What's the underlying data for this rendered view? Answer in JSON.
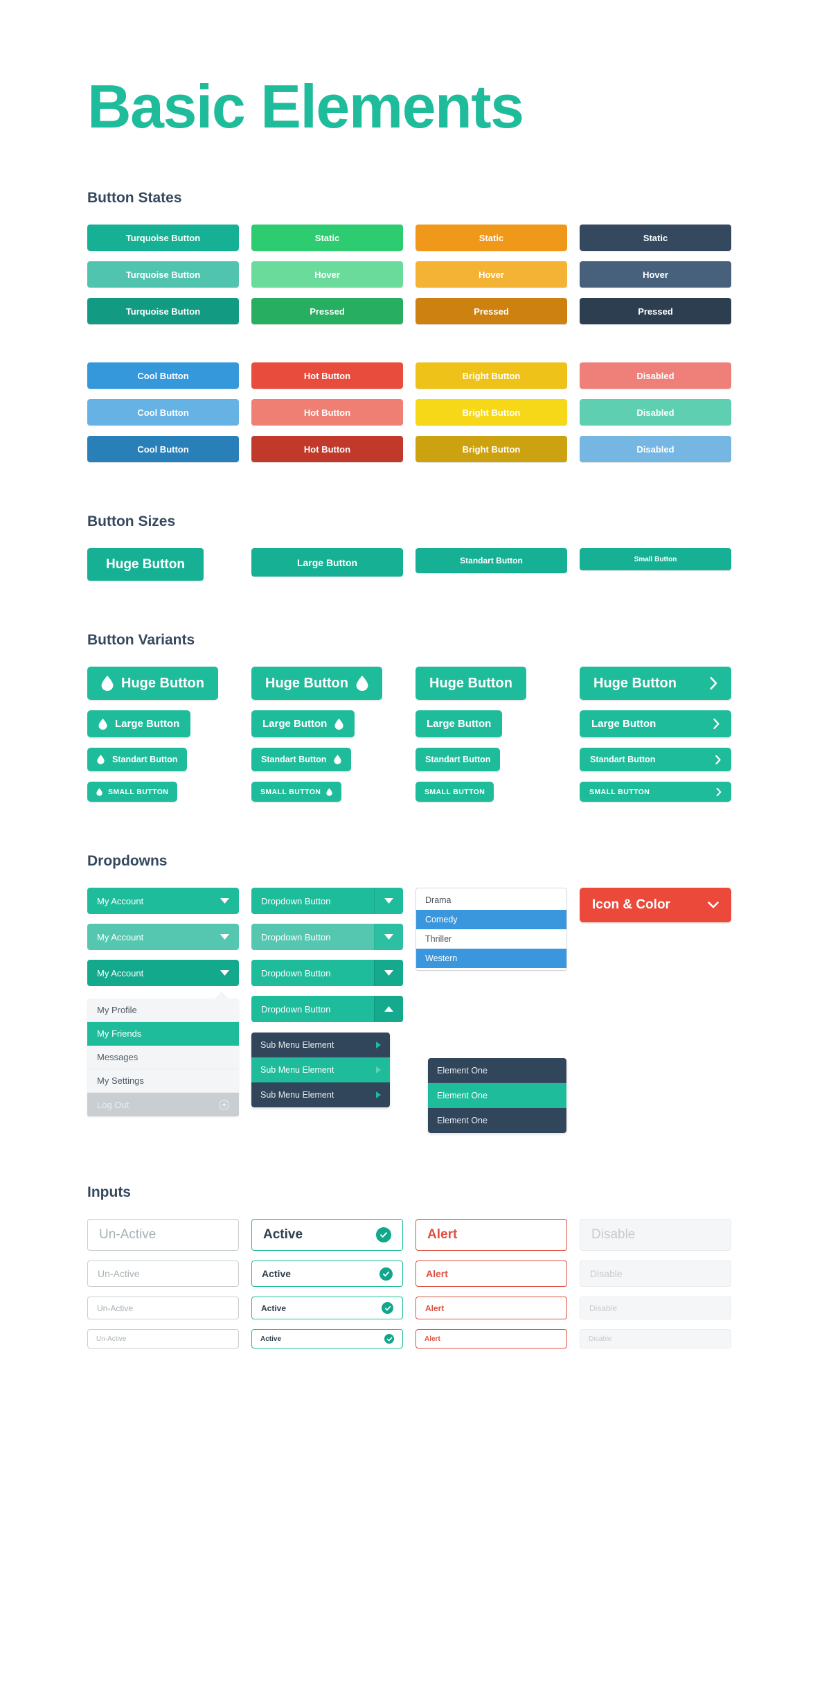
{
  "page": {
    "title": "Basic Elements",
    "accent": "#1ebc9b",
    "heading_color": "#34495e"
  },
  "sections": {
    "button_states": {
      "title": "Button States"
    },
    "button_sizes": {
      "title": "Button Sizes"
    },
    "button_variants": {
      "title": "Button Variants"
    },
    "dropdowns": {
      "title": "Dropdowns"
    },
    "inputs": {
      "title": "Inputs"
    }
  },
  "button_states": {
    "group_one": [
      {
        "name": "turquoise",
        "colors": {
          "static": "#16b194",
          "hover": "#50c4ae",
          "pressed": "#129b82"
        },
        "labels": {
          "static": "Turquoise Button",
          "hover": "Turquoise Button",
          "pressed": "Turquoise Button"
        }
      },
      {
        "name": "green",
        "colors": {
          "static": "#2ecc71",
          "hover": "#6bdb9b",
          "pressed": "#27ae60"
        },
        "labels": {
          "static": "Static",
          "hover": "Hover",
          "pressed": "Pressed"
        }
      },
      {
        "name": "orange",
        "colors": {
          "static": "#f09819",
          "hover": "#f5b335",
          "pressed": "#cd8110"
        },
        "labels": {
          "static": "Static",
          "hover": "Hover",
          "pressed": "Pressed"
        }
      },
      {
        "name": "dark",
        "colors": {
          "static": "#34495e",
          "hover": "#47617d",
          "pressed": "#2c3e50"
        },
        "labels": {
          "static": "Static",
          "hover": "Hover",
          "pressed": "Pressed"
        }
      }
    ],
    "group_two": [
      {
        "name": "cool",
        "colors": {
          "static": "#3498db",
          "hover": "#66b2e5",
          "pressed": "#2980b9"
        },
        "labels": {
          "static": "Cool Button",
          "hover": "Cool Button",
          "pressed": "Cool Button"
        }
      },
      {
        "name": "hot",
        "colors": {
          "static": "#e74c3c",
          "hover": "#ef7f72",
          "pressed": "#c0392b"
        },
        "labels": {
          "static": "Hot Button",
          "hover": "Hot Button",
          "pressed": "Hot Button"
        }
      },
      {
        "name": "bright",
        "colors": {
          "static": "#eec218",
          "hover": "#f6d818",
          "pressed": "#cca211"
        },
        "labels": {
          "static": "Bright Button",
          "hover": "Bright Button",
          "pressed": "Bright Button"
        }
      },
      {
        "name": "disabled",
        "colors": {
          "static": "#ef8079",
          "hover": "#5fcfb2",
          "pressed": "#75b6e3"
        },
        "labels": {
          "static": "Disabled",
          "hover": "Disabled",
          "pressed": "Disabled"
        }
      }
    ]
  },
  "button_sizes": [
    {
      "label": "Huge Button",
      "size": "huge"
    },
    {
      "label": "Large Button",
      "size": "large"
    },
    {
      "label": "Standart Button",
      "size": "standart"
    },
    {
      "label": "Small Button",
      "size": "small"
    }
  ],
  "button_variants": {
    "icon_name": "water-drop-icon",
    "arrow_icon_name": "chevron-right-icon",
    "rows": [
      {
        "size": "huge",
        "icon_left": "Huge Button",
        "icon_right": "Huge Button",
        "plain": "Huge Button",
        "arrow": "Huge Button"
      },
      {
        "size": "large",
        "icon_left": "Large Button",
        "icon_right": "Large Button",
        "plain": "Large Button",
        "arrow": "Large Button"
      },
      {
        "size": "standart",
        "icon_left": "Standart Button",
        "icon_right": "Standart Button",
        "plain": "Standart Button",
        "arrow": "Standart Button"
      },
      {
        "size": "small",
        "icon_left": "SMALL BUTTON",
        "icon_right": "SMALL BUTTON",
        "plain": "SMALL BUTTON",
        "arrow": "SMALL BUTTON"
      }
    ]
  },
  "dropdowns": {
    "account": {
      "static": "My Account",
      "hover": "My Account",
      "pressed": "My Account",
      "caret_icon": "caret-down-icon"
    },
    "split": {
      "static": "Dropdown Button",
      "hover": "Dropdown Button",
      "pressed": "Dropdown Button",
      "open": "Dropdown Button",
      "caret_down_icon": "caret-down-icon",
      "caret_up_icon": "caret-up-icon"
    },
    "select_list": {
      "options": [
        {
          "label": "Drama",
          "selected": false
        },
        {
          "label": "Comedy",
          "selected": true
        },
        {
          "label": "Thriller",
          "selected": false
        },
        {
          "label": "Western",
          "selected": true
        }
      ],
      "selected_color": "#3b97dd"
    },
    "icon_color_button": {
      "label": "Icon & Color",
      "color": "#eb4a3a",
      "chevron_icon": "chevron-down-icon"
    },
    "account_menu": {
      "items": [
        {
          "label": "My Profile",
          "state": "normal"
        },
        {
          "label": "My Friends",
          "state": "active"
        },
        {
          "label": "Messages",
          "state": "normal"
        },
        {
          "label": "My Settings",
          "state": "normal"
        },
        {
          "label": "Log Out",
          "state": "disabled",
          "icon": "plus-circle-icon"
        }
      ]
    },
    "sub_menu": {
      "items": [
        {
          "label": "Sub Menu Element",
          "state": "normal",
          "icon": "triangle-right-icon"
        },
        {
          "label": "Sub Menu Element",
          "state": "active",
          "icon": "triangle-right-icon"
        },
        {
          "label": "Sub Menu Element",
          "state": "normal",
          "icon": "triangle-right-icon"
        }
      ]
    },
    "nested_menu": {
      "items": [
        {
          "label": "Element One",
          "state": "normal"
        },
        {
          "label": "Element One",
          "state": "active"
        },
        {
          "label": "Element One",
          "state": "normal"
        }
      ]
    }
  },
  "inputs": {
    "check_icon": "check-circle-icon",
    "rows": [
      {
        "size": "huge",
        "unactive": "Un-Active",
        "active": "Active",
        "alert": "Alert",
        "disable": "Disable"
      },
      {
        "size": "large",
        "unactive": "Un-Active",
        "active": "Active",
        "alert": "Alert",
        "disable": "Disable"
      },
      {
        "size": "standart",
        "unactive": "Un-Active",
        "active": "Active",
        "alert": "Alert",
        "disable": "Disable"
      },
      {
        "size": "small",
        "unactive": "Un-Active",
        "active": "Active",
        "alert": "Alert",
        "disable": "Disable"
      }
    ]
  }
}
